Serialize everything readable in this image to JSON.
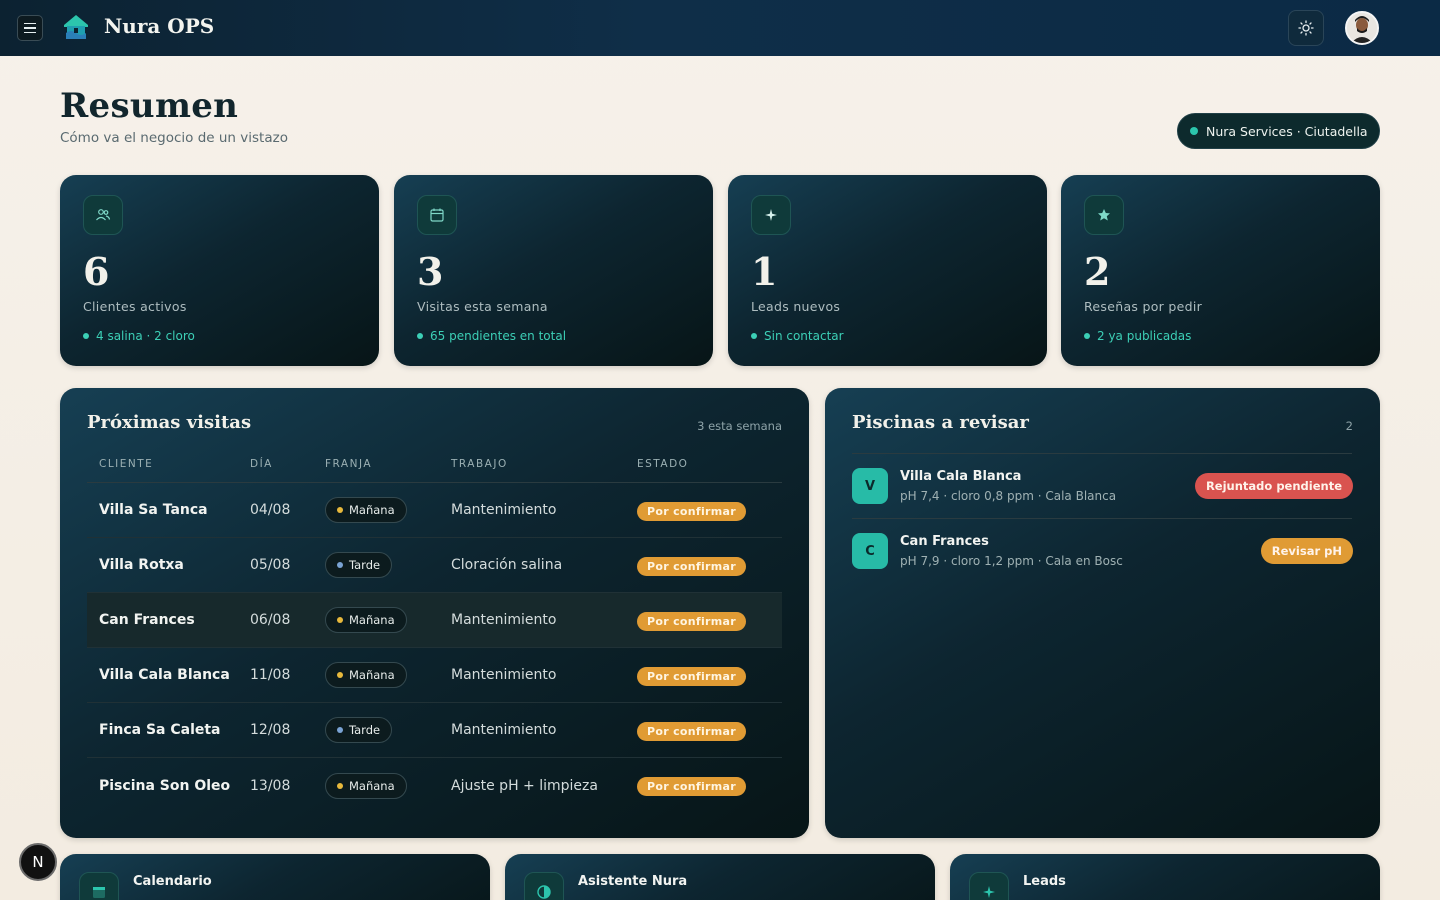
{
  "app": {
    "title": "Nura OPS"
  },
  "header": {
    "title": "Resumen",
    "subtitle": "Cómo va el negocio de un vistazo",
    "org_badge": "Nura Services · Ciutadella"
  },
  "stats": [
    {
      "icon": "users-icon",
      "value": "6",
      "label": "Clientes activos",
      "sub": "4 salina · 2 cloro"
    },
    {
      "icon": "calendar-icon",
      "value": "3",
      "label": "Visitas esta semana",
      "sub": "65 pendientes en total"
    },
    {
      "icon": "sparkle-icon",
      "value": "1",
      "label": "Leads nuevos",
      "sub": "Sin contactar"
    },
    {
      "icon": "star-icon",
      "value": "2",
      "label": "Reseñas por pedir",
      "sub": "2 ya publicadas"
    }
  ],
  "visits": {
    "title": "Próximas visitas",
    "meta": "3 esta semana",
    "columns": [
      "CLIENTE",
      "DÍA",
      "FRANJA",
      "TRABAJO",
      "ESTADO"
    ],
    "rows": [
      {
        "client": "Villa Sa Tanca",
        "day": "04/08",
        "slot": "Mañana",
        "job": "Mantenimiento",
        "status": "Por confirmar"
      },
      {
        "client": "Villa Rotxa",
        "day": "05/08",
        "slot": "Tarde",
        "job": "Cloración salina",
        "status": "Por confirmar"
      },
      {
        "client": "Can Frances",
        "day": "06/08",
        "slot": "Mañana",
        "job": "Mantenimiento",
        "status": "Por confirmar"
      },
      {
        "client": "Villa Cala Blanca",
        "day": "11/08",
        "slot": "Mañana",
        "job": "Mantenimiento",
        "status": "Por confirmar"
      },
      {
        "client": "Finca Sa Caleta",
        "day": "12/08",
        "slot": "Tarde",
        "job": "Mantenimiento",
        "status": "Por confirmar"
      },
      {
        "client": "Piscina Son Oleo",
        "day": "13/08",
        "slot": "Mañana",
        "job": "Ajuste pH + limpieza",
        "status": "Por confirmar"
      }
    ]
  },
  "pools": {
    "title": "Piscinas a revisar",
    "meta": "2",
    "items": [
      {
        "initial": "V",
        "name": "Villa Cala Blanca",
        "details": "pH 7,4 · cloro 0,8 ppm · Cala Blanca",
        "badge": "Rejuntado pendiente",
        "badge_color": "#d9534f"
      },
      {
        "initial": "C",
        "name": "Can Frances",
        "details": "pH 7,9 · cloro 1,2 ppm · Cala en Bosc",
        "badge": "Revisar pH",
        "badge_color": "#e09b34"
      }
    ]
  },
  "bottom_cards": [
    {
      "icon": "calendar-icon",
      "title": "Calendario"
    },
    {
      "icon": "half-circle-icon",
      "title": "Asistente Nura"
    },
    {
      "icon": "sparkle-icon",
      "title": "Leads"
    }
  ],
  "next_badge": "N",
  "colors": {
    "accent": "#2cc5ad",
    "warning": "#e09b34",
    "danger": "#d9534f",
    "morning_dot": "#e8b93c",
    "afternoon_dot": "#7aa3d4"
  }
}
